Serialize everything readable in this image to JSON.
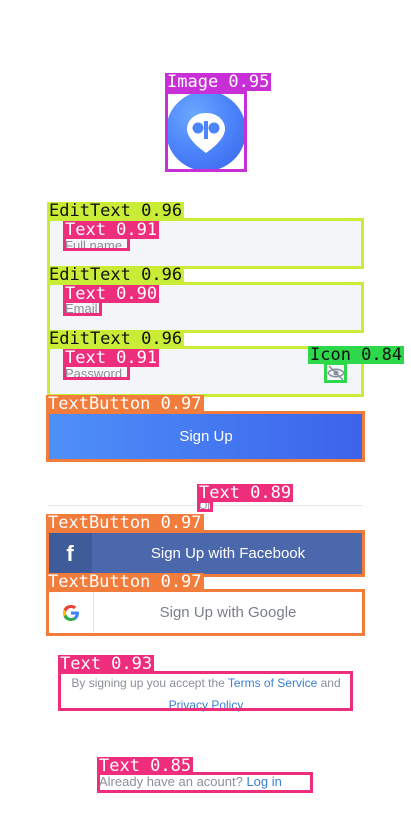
{
  "colors": {
    "image": "#c92fd6",
    "edittext": "#c9ed36",
    "text": "#ee2e7d",
    "icon": "#2dd84a",
    "textbutton": "#f27c3c"
  },
  "detections": {
    "image": "Image 0.95",
    "edit_full_name": "EditText 0.96",
    "text_full_name": "Text 0.91",
    "edit_email": "EditText 0.96",
    "text_email": "Text 0.90",
    "edit_password": "EditText 0.96",
    "text_password": "Text 0.91",
    "icon_eye": "Icon 0.84",
    "btn_signup": "TextButton 0.97",
    "text_or": "Text 0.89",
    "btn_facebook": "TextButton 0.97",
    "btn_google": "TextButton 0.97",
    "text_terms": "Text 0.93",
    "text_login": "Text 0.85"
  },
  "form": {
    "full_name_placeholder": "Full name",
    "email_placeholder": "Email",
    "password_placeholder": "Password"
  },
  "buttons": {
    "signup": "Sign Up",
    "facebook": "Sign Up with Facebook",
    "google": "Sign Up with Google"
  },
  "divider_text": "Or",
  "terms": {
    "prefix": "By signing up you accept the ",
    "tos": "Terms of Service",
    "and": " and",
    "privacy": "Privacy Policy"
  },
  "login": {
    "prompt": "Already have an acount? ",
    "link": "Log in"
  },
  "icons": {
    "logo": "location-pin-icon",
    "eye": "eye-off-icon",
    "facebook": "facebook-f-icon",
    "google": "google-g-icon"
  }
}
